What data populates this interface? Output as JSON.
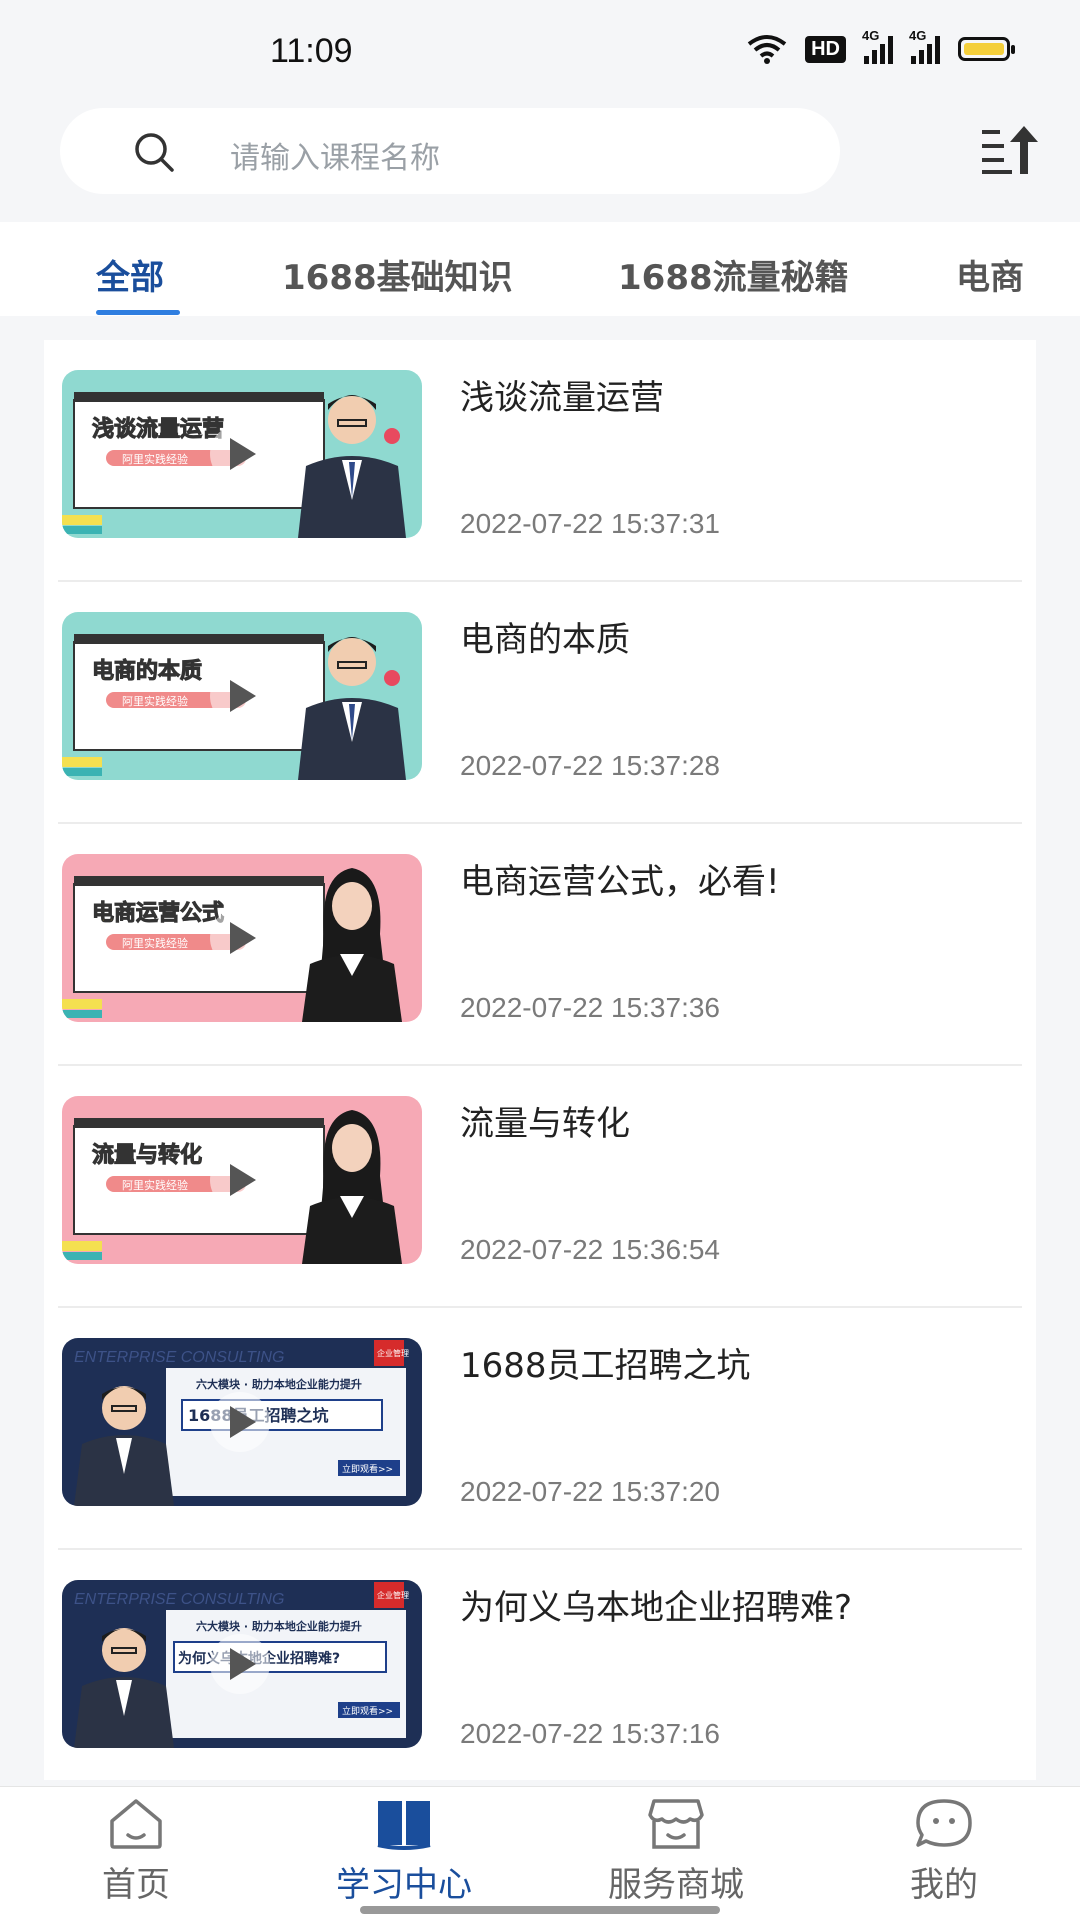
{
  "status_bar": {
    "time": "11:09",
    "icons": [
      "wifi-icon",
      "hd-icon",
      "signal-4g-icon",
      "signal-4g-icon",
      "battery-icon"
    ],
    "hd_label": "HD",
    "net_label": "4G"
  },
  "search": {
    "placeholder": "请输入课程名称",
    "icon": "search-icon"
  },
  "sort_icon": "sort-up-icon",
  "tabs": [
    {
      "label": "全部",
      "active": true
    },
    {
      "label": "1688基础知识",
      "active": false
    },
    {
      "label": "1688流量秘籍",
      "active": false
    },
    {
      "label": "电商",
      "active": false
    }
  ],
  "courses": [
    {
      "title": "浅谈流量运营",
      "date": "2022-07-22 15:37:31",
      "thumb": {
        "style": "teal",
        "headline": "浅谈流量运营",
        "tag": "阿里实践经验",
        "presenter": "male"
      }
    },
    {
      "title": "电商的本质",
      "date": "2022-07-22 15:37:28",
      "thumb": {
        "style": "teal",
        "headline": "电商的本质",
        "tag": "阿里实践经验",
        "presenter": "male"
      }
    },
    {
      "title": "电商运营公式，必看!",
      "date": "2022-07-22 15:37:36",
      "thumb": {
        "style": "pink",
        "headline": "电商运营公式",
        "tag": "阿里实践经验",
        "presenter": "female"
      }
    },
    {
      "title": "流量与转化",
      "date": "2022-07-22 15:36:54",
      "thumb": {
        "style": "pink",
        "headline": "流量与转化",
        "tag": "阿里实践经验",
        "presenter": "female"
      }
    },
    {
      "title": "1688员工招聘之坑",
      "date": "2022-07-22 15:37:20",
      "thumb": {
        "style": "navy",
        "headline": "1688员工招聘之坑",
        "banner": "六大模块 · 助力本地企业能力提升",
        "watermark": "ENTERPRISE CONSULTING",
        "cta": "立即观看>>",
        "corner": "企业管理"
      }
    },
    {
      "title": "为何义乌本地企业招聘难?",
      "date": "2022-07-22 15:37:16",
      "thumb": {
        "style": "navy",
        "headline": "为何义乌本地企业招聘难?",
        "banner": "六大模块 · 助力本地企业能力提升",
        "watermark": "ENTERPRISE CONSULTING",
        "cta": "立即观看>>",
        "corner": "企业管理"
      }
    }
  ],
  "bottom_nav": [
    {
      "label": "首页",
      "icon": "home-icon",
      "active": false
    },
    {
      "label": "学习中心",
      "icon": "book-icon",
      "active": true
    },
    {
      "label": "服务商城",
      "icon": "store-icon",
      "active": false
    },
    {
      "label": "我的",
      "icon": "chat-face-icon",
      "active": false
    }
  ],
  "colors": {
    "accent": "#1a4e9c",
    "tab_underline": "#2f7ee0",
    "background": "#f5f6f8",
    "teal_thumb": "#8fd9d0",
    "pink_thumb": "#f6a9b5",
    "navy_thumb": "#1e2f55",
    "battery": "#f4cf3c"
  }
}
